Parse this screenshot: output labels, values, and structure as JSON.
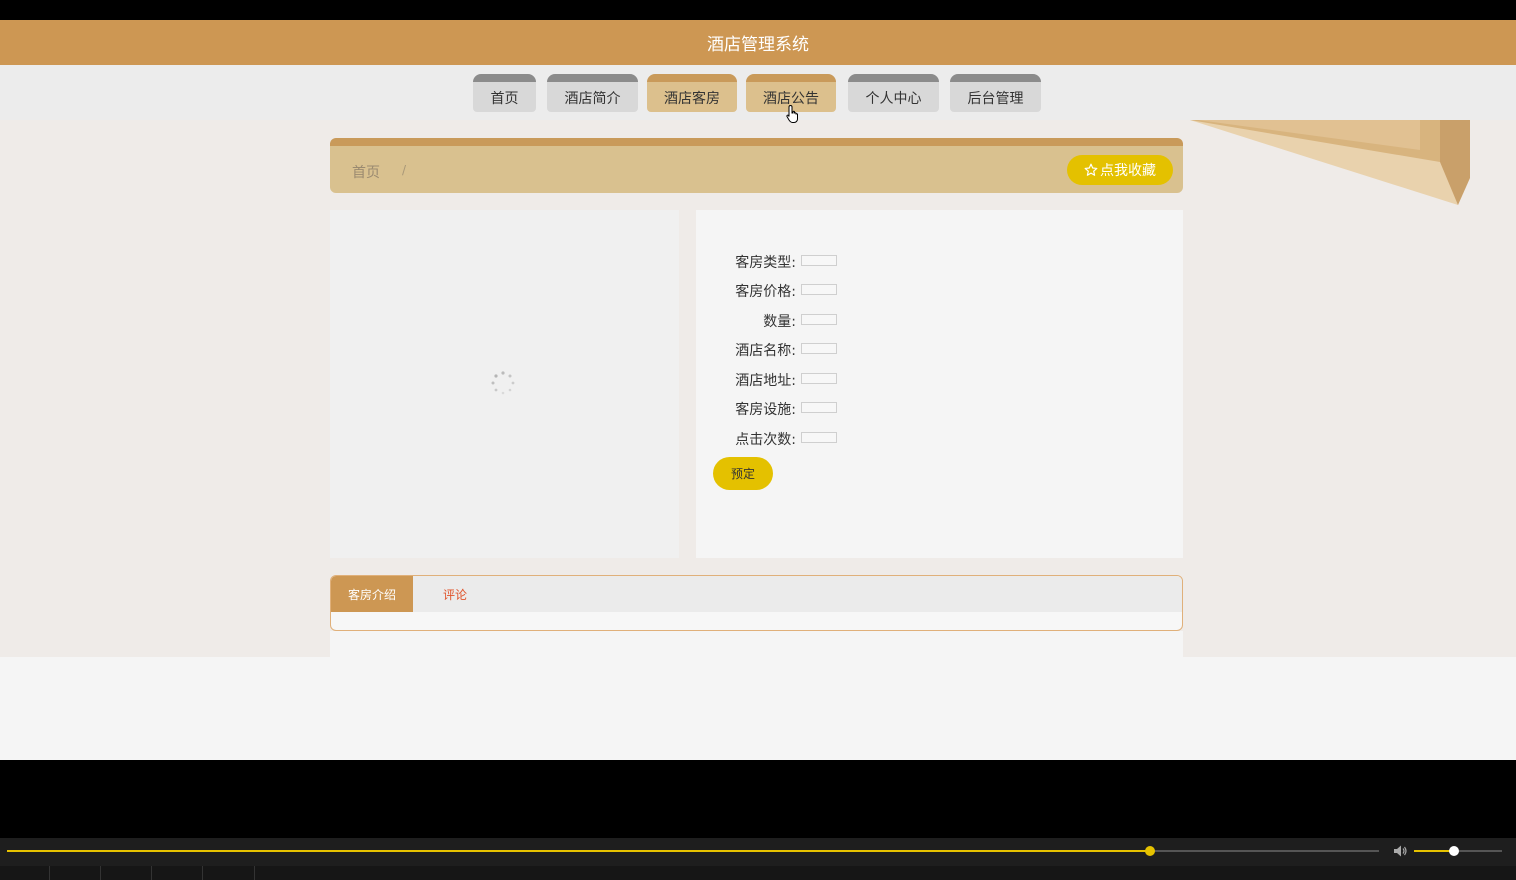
{
  "header": {
    "title": "酒店管理系统"
  },
  "nav": {
    "items": [
      {
        "label": "首页"
      },
      {
        "label": "酒店简介"
      },
      {
        "label": "酒店客房"
      },
      {
        "label": "酒店公告"
      },
      {
        "label": "个人中心"
      },
      {
        "label": "后台管理"
      }
    ],
    "active_index": 2
  },
  "breadcrumb": {
    "home": "首页",
    "separator": "/"
  },
  "favorite_button": {
    "icon": "star-outline-icon",
    "label": "点我收藏"
  },
  "details": {
    "fields": [
      {
        "label": "客房类型:",
        "value": ""
      },
      {
        "label": "客房价格:",
        "value": ""
      },
      {
        "label": "数量:",
        "value": ""
      },
      {
        "label": "酒店名称:",
        "value": ""
      },
      {
        "label": "酒店地址:",
        "value": ""
      },
      {
        "label": "客房设施:",
        "value": ""
      },
      {
        "label": "点击次数:",
        "value": ""
      }
    ],
    "book_label": "预定"
  },
  "tabs": {
    "items": [
      {
        "label": "客房介绍"
      },
      {
        "label": "评论"
      }
    ],
    "active_index": 0
  },
  "player": {
    "progress": 0.833,
    "volume": 0.45
  },
  "colors": {
    "brand": "#cd9753",
    "accent_yellow": "#e4c100",
    "comment_tab": "#e0532a"
  }
}
